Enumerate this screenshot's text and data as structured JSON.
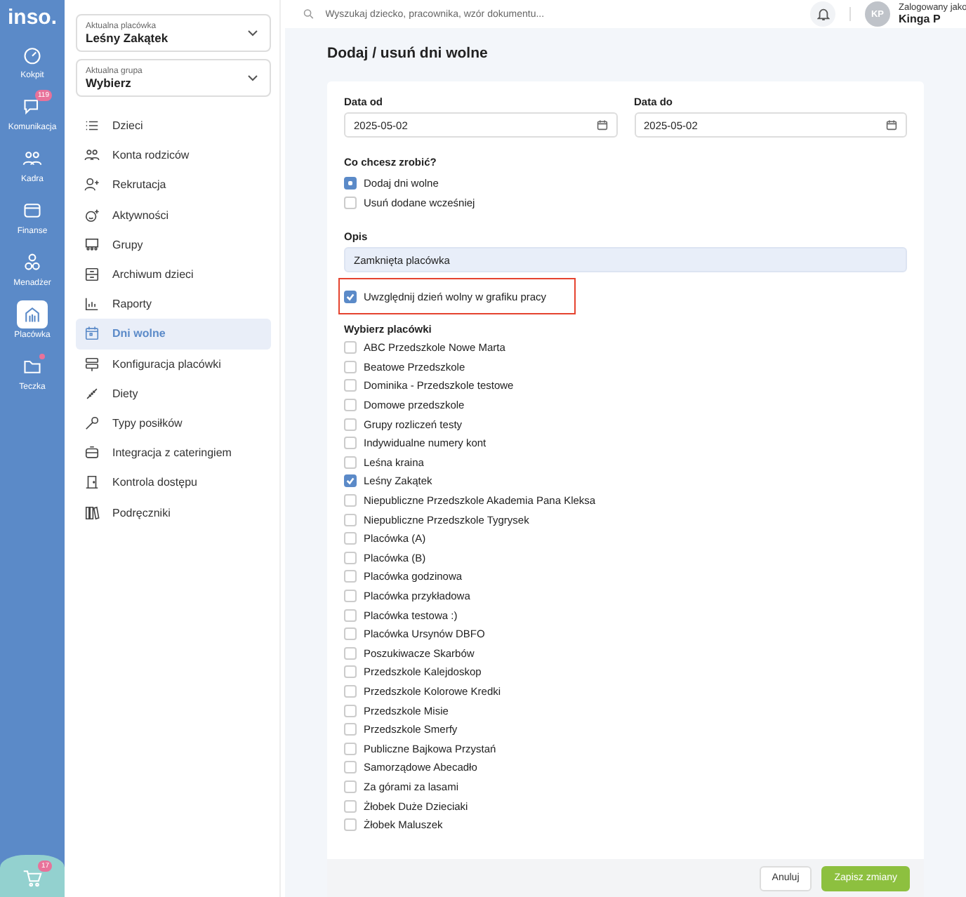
{
  "logo": "inso.",
  "rail": [
    {
      "label": "Kokpit",
      "selected": false
    },
    {
      "label": "Komunikacja",
      "selected": false,
      "badge": "119"
    },
    {
      "label": "Kadra",
      "selected": false
    },
    {
      "label": "Finanse",
      "selected": false
    },
    {
      "label": "Menadżer",
      "selected": false
    },
    {
      "label": "Placówka",
      "selected": true
    },
    {
      "label": "Teczka",
      "selected": false,
      "dot": true
    }
  ],
  "whats_new": {
    "badge": "17"
  },
  "selectors": [
    {
      "label": "Aktualna placówka",
      "value": "Leśny Zakątek"
    },
    {
      "label": "Aktualna grupa",
      "value": "Wybierz"
    }
  ],
  "menu": [
    {
      "label": "Dzieci",
      "selected": false
    },
    {
      "label": "Konta rodziców",
      "selected": false
    },
    {
      "label": "Rekrutacja",
      "selected": false
    },
    {
      "label": "Aktywności",
      "selected": false
    },
    {
      "label": "Grupy",
      "selected": false
    },
    {
      "label": "Archiwum dzieci",
      "selected": false
    },
    {
      "label": "Raporty",
      "selected": false
    },
    {
      "label": "Dni wolne",
      "selected": true
    },
    {
      "label": "Konfiguracja placówki",
      "selected": false
    },
    {
      "label": "Diety",
      "selected": false
    },
    {
      "label": "Typy posiłków",
      "selected": false
    },
    {
      "label": "Integracja z cateringiem",
      "selected": false
    },
    {
      "label": "Kontrola dostępu",
      "selected": false
    },
    {
      "label": "Podręczniki",
      "selected": false
    }
  ],
  "search": {
    "placeholder": "Wyszukaj dziecko, pracownika, wzór dokumentu..."
  },
  "user": {
    "initials": "KP",
    "caption": "Zalogowany jako",
    "name": "Kinga P"
  },
  "page_title": "Dodaj / usuń dni wolne",
  "date_from": {
    "label": "Data od",
    "value": "2025-05-02"
  },
  "date_to": {
    "label": "Data do",
    "value": "2025-05-02"
  },
  "action": {
    "label": "Co chcesz zrobić?",
    "options": [
      {
        "label": "Dodaj dni wolne",
        "selected": true
      },
      {
        "label": "Usuń dodane wcześniej",
        "selected": false
      }
    ]
  },
  "description": {
    "label": "Opis",
    "value": "Zamknięta placówka"
  },
  "include_in_schedule": {
    "label": "Uwzględnij dzień wolny w grafiku pracy",
    "checked": true,
    "highlighted": true
  },
  "facilities": {
    "label": "Wybierz placówki",
    "items": [
      {
        "label": "ABC Przedszkole Nowe Marta",
        "checked": false
      },
      {
        "label": "Beatowe Przedszkole",
        "checked": false
      },
      {
        "label": "Dominika - Przedszkole testowe",
        "checked": false
      },
      {
        "label": "Domowe przedszkole",
        "checked": false
      },
      {
        "label": "Grupy rozliczeń testy",
        "checked": false
      },
      {
        "label": "Indywidualne numery kont",
        "checked": false
      },
      {
        "label": "Leśna kraina",
        "checked": false
      },
      {
        "label": "Leśny Zakątek",
        "checked": true
      },
      {
        "label": "Niepubliczne Przedszkole Akademia Pana Kleksa",
        "checked": false
      },
      {
        "label": "Niepubliczne Przedszkole Tygrysek",
        "checked": false
      },
      {
        "label": "Placówka (A)",
        "checked": false
      },
      {
        "label": "Placówka (B)",
        "checked": false
      },
      {
        "label": "Placówka godzinowa",
        "checked": false
      },
      {
        "label": "Placówka przykładowa",
        "checked": false
      },
      {
        "label": "Placówka testowa :)",
        "checked": false
      },
      {
        "label": "Placówka Ursynów DBFO",
        "checked": false
      },
      {
        "label": "Poszukiwacze Skarbów",
        "checked": false
      },
      {
        "label": "Przedszkole Kalejdoskop",
        "checked": false
      },
      {
        "label": "Przedszkole Kolorowe Kredki",
        "checked": false
      },
      {
        "label": "Przedszkole Misie",
        "checked": false
      },
      {
        "label": "Przedszkole Smerfy",
        "checked": false
      },
      {
        "label": "Publiczne Bajkowa Przystań",
        "checked": false
      },
      {
        "label": "Samorządowe Abecadło",
        "checked": false
      },
      {
        "label": "Za górami za lasami",
        "checked": false
      },
      {
        "label": "Żłobek Duże Dzieciaki",
        "checked": false
      },
      {
        "label": "Żłobek Maluszek",
        "checked": false
      }
    ]
  },
  "buttons": [
    {
      "label": "Anuluj",
      "kind": "secondary"
    },
    {
      "label": "Zapisz zmiany",
      "kind": "primary"
    }
  ]
}
